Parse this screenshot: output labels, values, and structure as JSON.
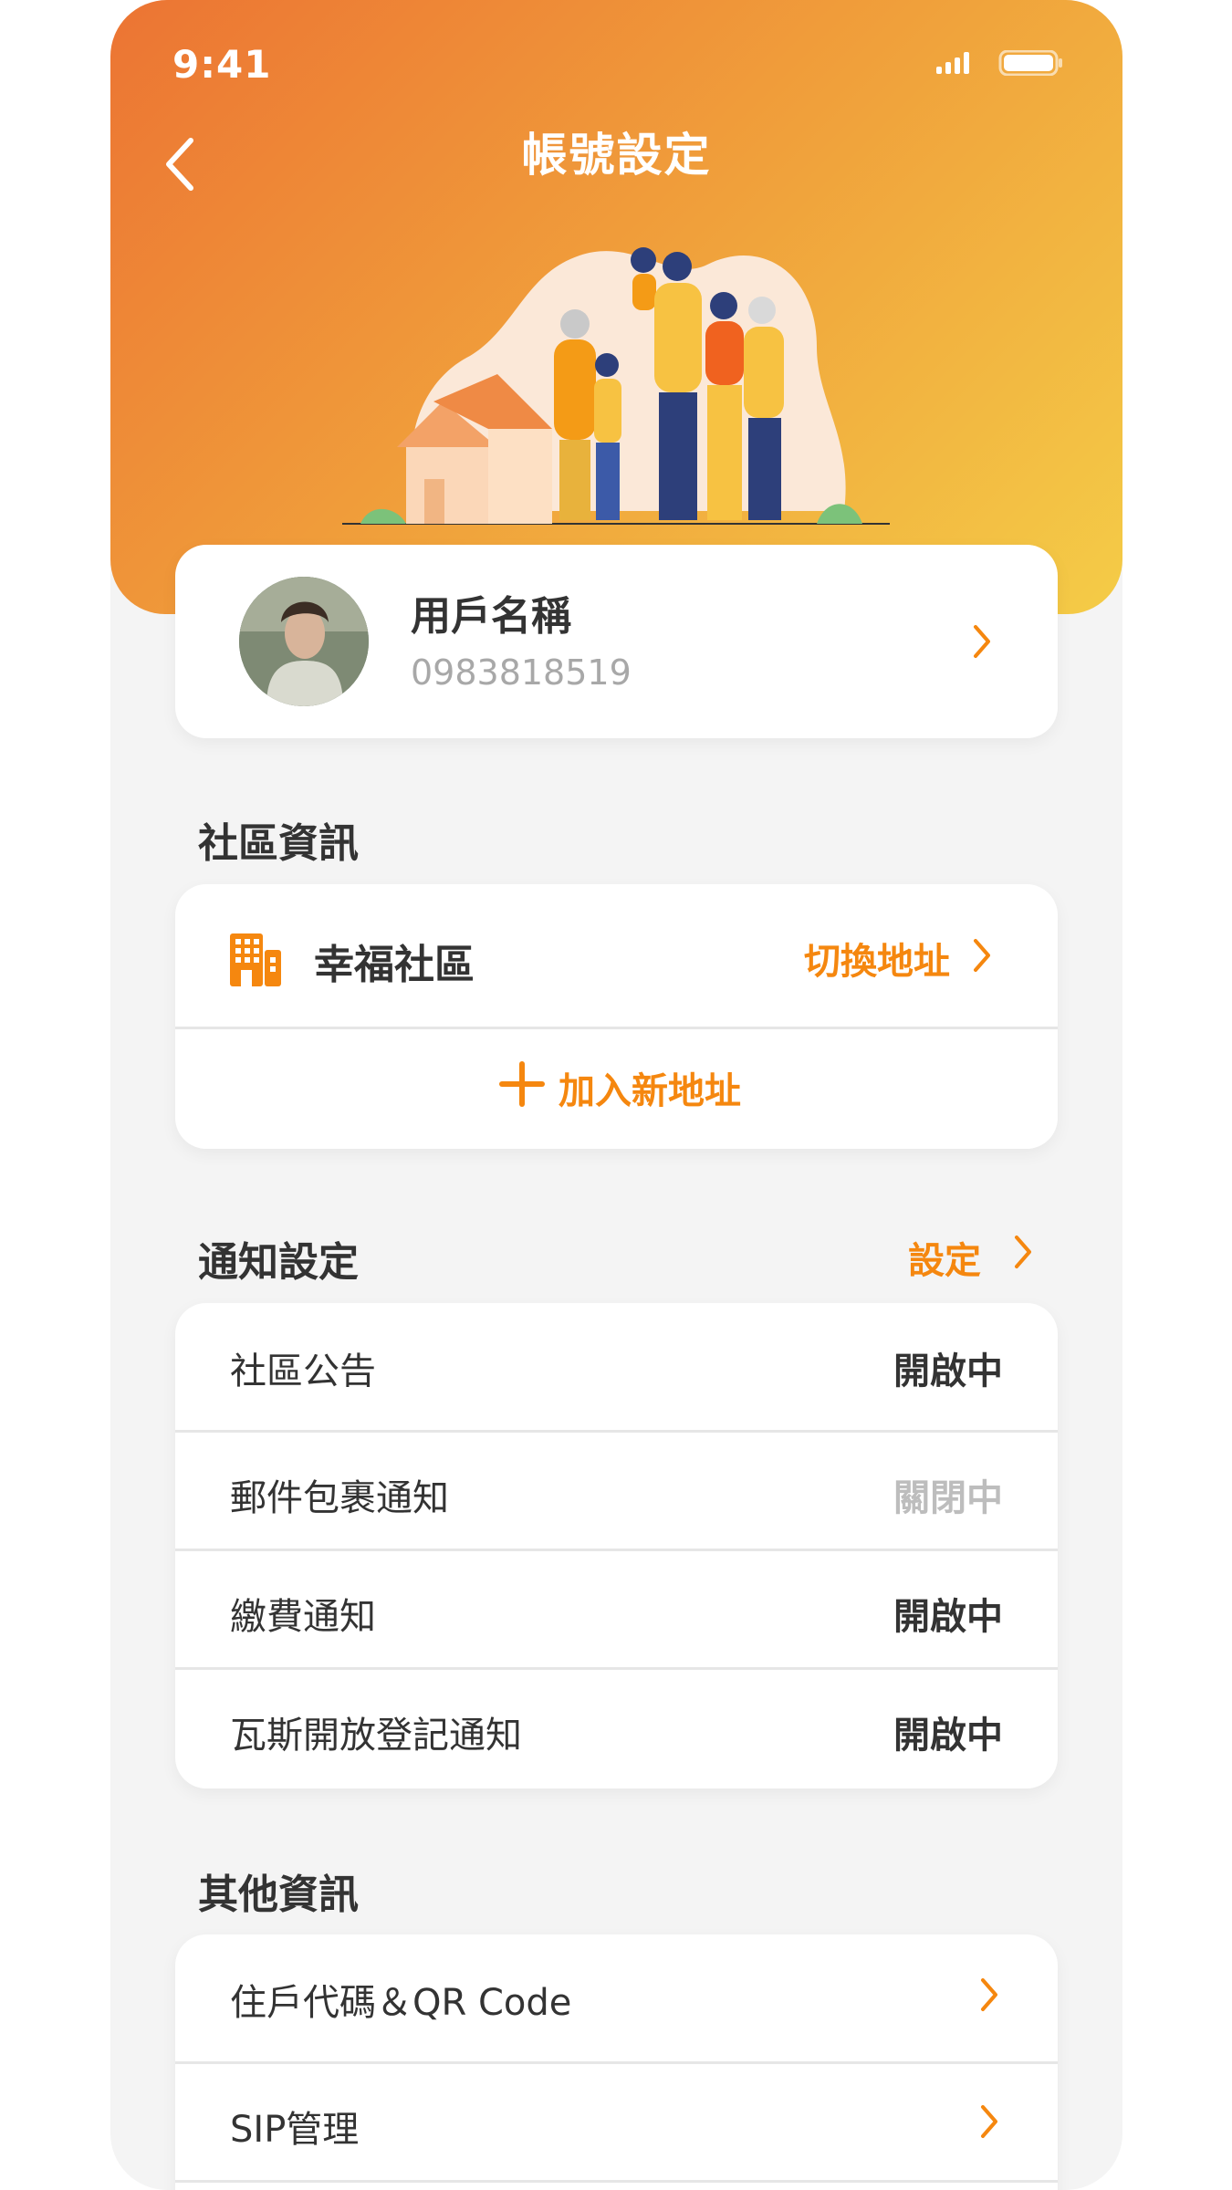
{
  "status_bar": {
    "time": "9:41"
  },
  "header": {
    "title": "帳號設定"
  },
  "profile": {
    "name": "用戶名稱",
    "phone": "0983818519"
  },
  "community": {
    "section_title": "社區資訊",
    "name": "幸福社區",
    "switch_label": "切換地址",
    "add_label": "加入新地址"
  },
  "notifications": {
    "section_title": "通知設定",
    "settings_link": "設定",
    "items": [
      {
        "label": "社區公告",
        "status": "開啟中"
      },
      {
        "label": "郵件包裹通知",
        "status": "關閉中"
      },
      {
        "label": "繳費通知",
        "status": "開啟中"
      },
      {
        "label": "瓦斯開放登記通知",
        "status": "開啟中"
      }
    ]
  },
  "other": {
    "section_title": "其他資訊",
    "items": [
      {
        "label": "住戶代碼＆QR Code"
      },
      {
        "label": "SIP管理"
      }
    ]
  },
  "colors": {
    "accent": "#f5870f",
    "header_start": "#ec7433",
    "header_end": "#f4cc47",
    "background": "#f4f4f4"
  },
  "icons": [
    "back-icon",
    "signal-icon",
    "battery-icon",
    "building-icon",
    "plus-icon",
    "chevron-right-icon"
  ]
}
